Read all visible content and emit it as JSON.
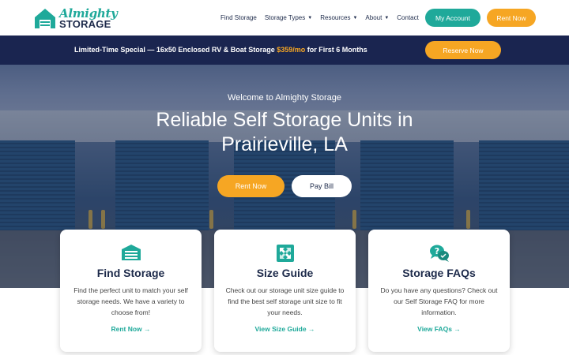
{
  "brand": {
    "name_top": "Almighty",
    "name_bottom": "STORAGE"
  },
  "nav": {
    "items": [
      {
        "label": "Find Storage",
        "has_caret": false
      },
      {
        "label": "Storage Types",
        "has_caret": true
      },
      {
        "label": "Resources",
        "has_caret": true
      },
      {
        "label": "About",
        "has_caret": true
      },
      {
        "label": "Contact",
        "has_caret": false
      }
    ],
    "account_label": "My Account",
    "rent_label": "Rent Now"
  },
  "promo": {
    "text_before": "Limited-Time Special — 16x50 Enclosed RV & Boat Storage ",
    "price": "$359/mo",
    "text_after": " for First 6 Months",
    "button_label": "Reserve Now"
  },
  "hero": {
    "subtitle": "Welcome to Almighty Storage",
    "title": "Reliable Self Storage Units in Prairieville, LA",
    "primary_button": "Rent Now",
    "secondary_button": "Pay Bill"
  },
  "cards": [
    {
      "icon": "garage-icon",
      "title": "Find Storage",
      "description": "Find the perfect unit to match your self storage needs. We have a variety to choose from!",
      "link": "Rent Now"
    },
    {
      "icon": "resize-arrows-icon",
      "title": "Size Guide",
      "description": "Check out our storage unit size guide to find the best self storage unit size to fit your needs.",
      "link": "View Size Guide"
    },
    {
      "icon": "question-chat-icon",
      "title": "Storage FAQs",
      "description": "Do you have any questions? Check out our Self Storage FAQ for more information.",
      "link": "View FAQs"
    }
  ],
  "colors": {
    "teal": "#1fa99a",
    "orange": "#f6a623",
    "navy": "#1a2550"
  }
}
